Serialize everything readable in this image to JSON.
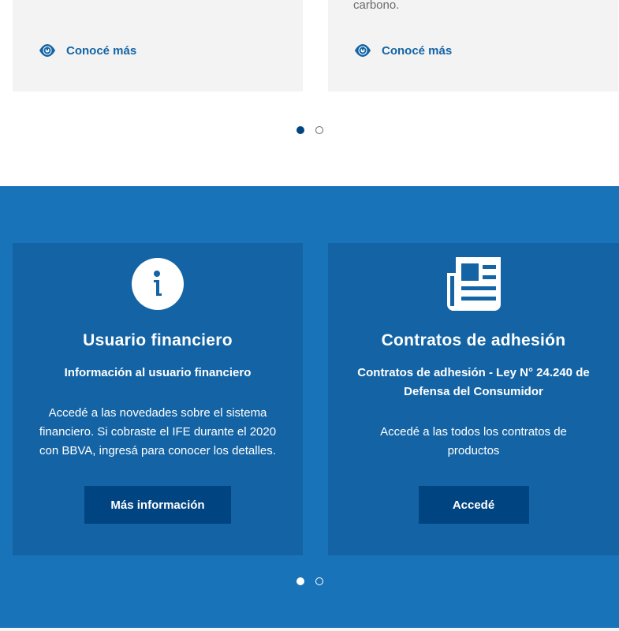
{
  "top_cards": {
    "right_tail_text": "carbono.",
    "left_link_label": "Conocé más",
    "right_link_label": "Conocé más",
    "link_icon": "eye-icon"
  },
  "top_carousel": {
    "total": 2,
    "active": 1
  },
  "blue_cards": [
    {
      "icon": "info-icon",
      "title": "Usuario financiero",
      "subtitle": "Información al usuario financiero",
      "description": "Accedé a las novedades sobre el sistema financiero. Si cobraste el IFE durante el 2020 con BBVA, ingresá para conocer los detalles.",
      "button_label": "Más información"
    },
    {
      "icon": "newspaper-icon",
      "title": "Contratos de adhesión",
      "subtitle": "Contratos de adhesión - Ley N° 24.240 de Defensa del Consumidor",
      "description": "Accedé a las todos los contratos de productos",
      "button_label": "Accedé"
    }
  ],
  "blue_carousel": {
    "total": 2,
    "active": 1
  },
  "colors": {
    "link": "#1464a5",
    "section_bg": "#1973b8",
    "card_bg": "#1464a5",
    "button_bg": "#004481",
    "gray_card": "#f3f3f3"
  }
}
